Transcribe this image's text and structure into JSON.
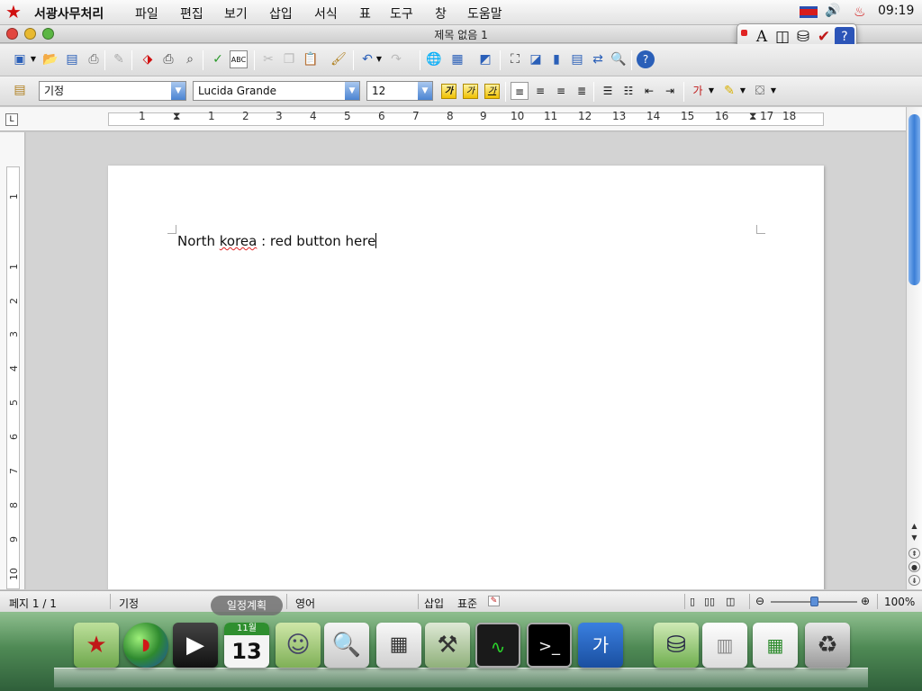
{
  "menubar": {
    "app_name": "서광사무처리",
    "menus": [
      "파일",
      "편집",
      "보기",
      "삽입",
      "서식",
      "표",
      "도구",
      "창",
      "도움말"
    ],
    "clock": "09:19"
  },
  "window": {
    "title": "제목 없음 1"
  },
  "format_toolbar": {
    "paragraph_style": "기정",
    "font_name": "Lucida Grande",
    "font_size": "12"
  },
  "ruler": {
    "h_numbers": [
      "1",
      "1",
      "2",
      "3",
      "4",
      "5",
      "6",
      "7",
      "8",
      "9",
      "10",
      "11",
      "12",
      "13",
      "14",
      "15",
      "16",
      "17",
      "18"
    ],
    "v_numbers": [
      "1",
      "1",
      "2",
      "3",
      "4",
      "5",
      "6",
      "7",
      "8",
      "9",
      "10"
    ]
  },
  "document": {
    "text_before": "North ",
    "misspelled_word": "korea",
    "text_after": " : red button here"
  },
  "statusbar": {
    "page_info": "페지 1 / 1",
    "page_style": "기정",
    "language": "영어",
    "insert_mode": "삽입",
    "selection_mode": "표준",
    "zoom": "100%",
    "zoom_fraction": 0.5
  },
  "dock": {
    "tooltip": "일정계획",
    "calendar_month": "11월",
    "calendar_day": "13"
  },
  "colors": {
    "red_star": "#d01010",
    "accent_blue": "#3b7fd6",
    "dock_green": "#4f8a55"
  }
}
